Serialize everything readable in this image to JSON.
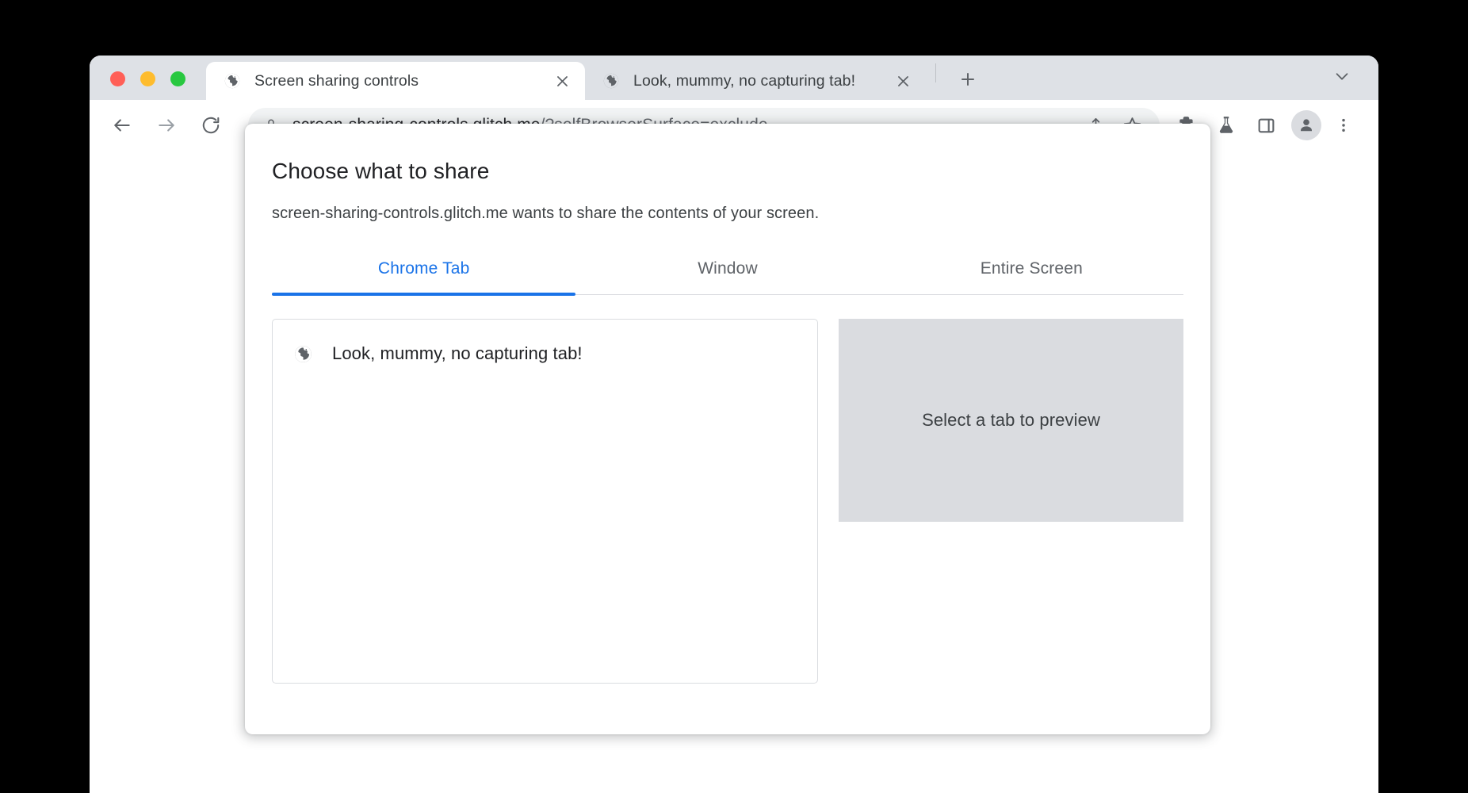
{
  "window": {
    "traffic_lights": [
      {
        "name": "close",
        "color": "#ff5f57"
      },
      {
        "name": "minimize",
        "color": "#febc2e"
      },
      {
        "name": "zoom",
        "color": "#28c840"
      }
    ]
  },
  "tabstrip": {
    "tabs": [
      {
        "title": "Screen sharing controls",
        "active": true,
        "favicon": "globe-icon",
        "close_label": "✕"
      },
      {
        "title": "Look, mummy, no capturing tab!",
        "active": false,
        "favicon": "globe-icon",
        "close_label": "✕"
      }
    ],
    "new_tab_label": "+",
    "tab_search_label": "⌄"
  },
  "toolbar": {
    "back_label": "←",
    "forward_label": "→",
    "reload_label": "↻",
    "url_host": "screen-sharing-controls.glitch.me",
    "url_path": "/?selfBrowserSurface=exclude",
    "lock_icon": "lock-icon",
    "share_icon": "share-icon",
    "bookmark_icon": "star-icon",
    "extensions_icon": "puzzle-icon",
    "labs_icon": "flask-icon",
    "side_panel_icon": "side-panel-icon",
    "profile_icon": "person-icon",
    "menu_icon": "three-dot-menu-icon"
  },
  "dialog": {
    "title": "Choose what to share",
    "description": "screen-sharing-controls.glitch.me wants to share the contents of your screen.",
    "tabs": [
      {
        "label": "Chrome Tab",
        "active": true
      },
      {
        "label": "Window",
        "active": false
      },
      {
        "label": "Entire Screen",
        "active": false
      }
    ],
    "tab_list": [
      {
        "title": "Look, mummy, no capturing tab!",
        "favicon": "globe-icon"
      }
    ],
    "preview_placeholder": "Select a tab to preview"
  },
  "colors": {
    "accent": "#1a73e8",
    "tabstrip_bg": "#dee1e6",
    "omnibox_bg": "#f1f3f4",
    "preview_bg": "#dadce0"
  }
}
